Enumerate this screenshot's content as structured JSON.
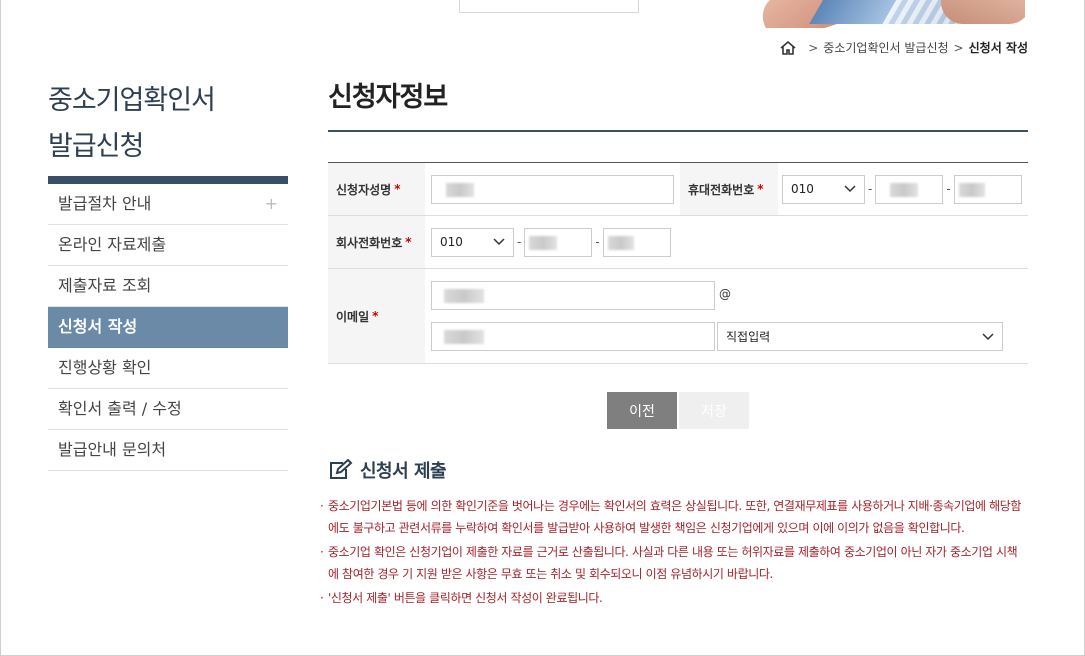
{
  "breadcrumb": {
    "items": [
      "중소기업확인서 발급신청",
      "신청서 작성"
    ]
  },
  "sidebar": {
    "title_line1": "중소기업확인서",
    "title_line2": "발급신청",
    "items": [
      {
        "label": "발급절차 안내",
        "icon": "plus-icon"
      },
      {
        "label": "온라인 자료제출"
      },
      {
        "label": "제출자료 조회"
      },
      {
        "label": "신청서 작성",
        "active": true
      },
      {
        "label": "진행상황 확인"
      },
      {
        "label": "확인서 출력 / 수정"
      },
      {
        "label": "발급안내 문의처"
      }
    ]
  },
  "main": {
    "title": "신청자정보",
    "form": {
      "applicant_name_label": "신청자성명",
      "mobile_label": "휴대전화번호",
      "mobile_prefix": "010",
      "company_phone_label": "회사전화번호",
      "company_phone_prefix": "010",
      "email_label": "이메일",
      "email_at": "@",
      "email_domain_select": "직접입력",
      "required_mark": "*",
      "dash": "-"
    },
    "buttons": {
      "prev": "이전",
      "save": "저장"
    },
    "submit": {
      "title": "신청서 제출",
      "notes": [
        "중소기업기본법 등에 의한 확인기준을 벗어나는 경우에는 확인서의 효력은 상실됩니다. 또한, 연결재무제표를 사용하거나 지배·종속기업에 해당함에도 불구하고 관련서류를 누락하여 확인서를 발급받아 사용하여 발생한 책임은 신청기업에게 있으며 이에 이의가 없음을 확인합니다.",
        "중소기업 확인은 신청기업이 제출한 자료를 근거로 산출됩니다. 사실과 다른 내용 또는 허위자료를 제출하여 중소기업이 아닌 자가 중소기업 시책에 참여한 경우 기 지원 받은 사항은 무효 또는 취소 및 회수되오니 이점 유념하시기 바랍니다.",
        "'신청서 제출' 버튼을 클릭하면 신청서 작성이 완료됩니다."
      ]
    }
  },
  "colors": {
    "accent": "#3a4e66",
    "menu_active": "#6b8aa8",
    "notice": "#a5232b"
  }
}
